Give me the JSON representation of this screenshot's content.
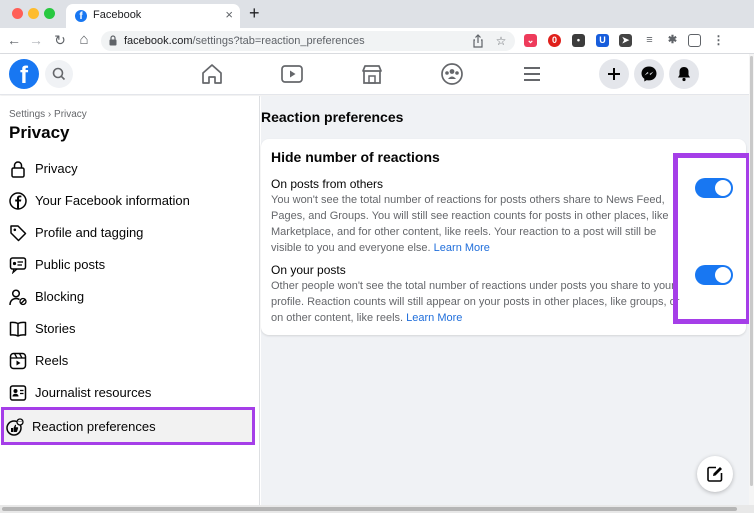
{
  "browser": {
    "tab_title": "Facebook",
    "tab_favicon": "f",
    "tab_close": "×",
    "new_tab": "+",
    "back": "←",
    "forward": "→",
    "reload": "↻",
    "home": "⌂",
    "url_domain": "facebook.com",
    "url_path": "/settings?tab=reaction_preferences"
  },
  "header": {
    "logo": "f"
  },
  "sidebar": {
    "breadcrumb": "Settings › Privacy",
    "title": "Privacy",
    "items": [
      {
        "label": "Privacy",
        "icon": "lock-icon"
      },
      {
        "label": "Your Facebook information",
        "icon": "facebook-circle-icon"
      },
      {
        "label": "Profile and tagging",
        "icon": "tag-icon"
      },
      {
        "label": "Public posts",
        "icon": "public-posts-icon"
      },
      {
        "label": "Blocking",
        "icon": "block-user-icon"
      },
      {
        "label": "Stories",
        "icon": "book-icon"
      },
      {
        "label": "Reels",
        "icon": "reels-icon"
      },
      {
        "label": "Journalist resources",
        "icon": "journalist-icon"
      },
      {
        "label": "Reaction preferences",
        "icon": "reaction-icon",
        "active": true
      }
    ]
  },
  "main": {
    "heading": "Reaction preferences",
    "card": {
      "title": "Hide number of reactions",
      "sections": [
        {
          "title": "On posts from others",
          "description": "You won't see the total number of reactions for posts others share to News Feed, Pages, and Groups. You will still see reaction counts for posts in other places, like Marketplace, and for other content, like reels. Your reaction to a post will still be visible to you and everyone else.",
          "learn_more": "Learn More",
          "toggle_on": true
        },
        {
          "title": "On your posts",
          "description": "Other people won't see the total number of reactions under posts you share to your profile. Reaction counts will still appear on your posts in other places, like groups, or on other content, like reels.",
          "learn_more": "Learn More",
          "toggle_on": true
        }
      ]
    }
  },
  "colors": {
    "accent": "#1877f2",
    "highlight": "#a53ee8",
    "link": "#216fdb"
  }
}
